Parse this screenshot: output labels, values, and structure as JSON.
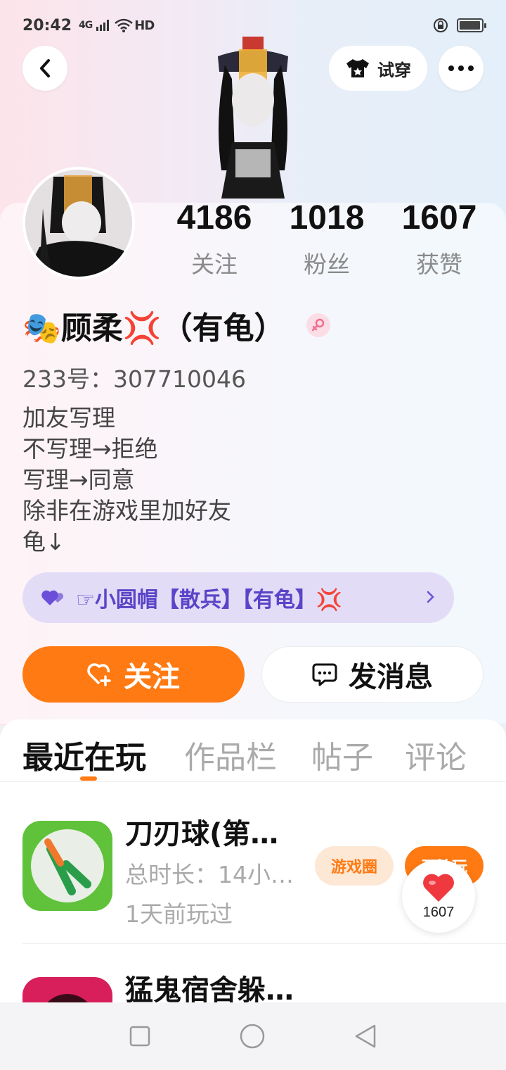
{
  "status_bar": {
    "time": "20:42",
    "signal": "4G",
    "hd": "HD"
  },
  "header": {
    "try_on_label": "试穿"
  },
  "stats": [
    {
      "value": "4186",
      "label": "关注"
    },
    {
      "value": "1018",
      "label": "粉丝"
    },
    {
      "value": "1607",
      "label": "获赞"
    }
  ],
  "profile": {
    "name": "🎭顾柔💢（有龟）",
    "uid": "233号：307710046",
    "bio": [
      "加友写理",
      "不写理→拒绝",
      "写理→同意",
      "除非在游戏里加好友",
      "龟↓"
    ]
  },
  "group": {
    "label": "☞小圆帽【散兵】【有龟】💢"
  },
  "actions": {
    "follow": "关注",
    "message": "发消息"
  },
  "tabs": [
    "最近在玩",
    "作品栏",
    "帖子",
    "评论"
  ],
  "games": [
    {
      "title": "刀刃球(第…",
      "duration": "总时长：14小…",
      "last_played": "1天前玩过",
      "circle_label": "游戏圈",
      "play_label": "开始玩"
    },
    {
      "title": "猛鬼宿舍躲…"
    }
  ],
  "like_float": {
    "count": "1607"
  },
  "colors": {
    "accent": "#ff7a12",
    "group_text": "#5a44c8"
  }
}
